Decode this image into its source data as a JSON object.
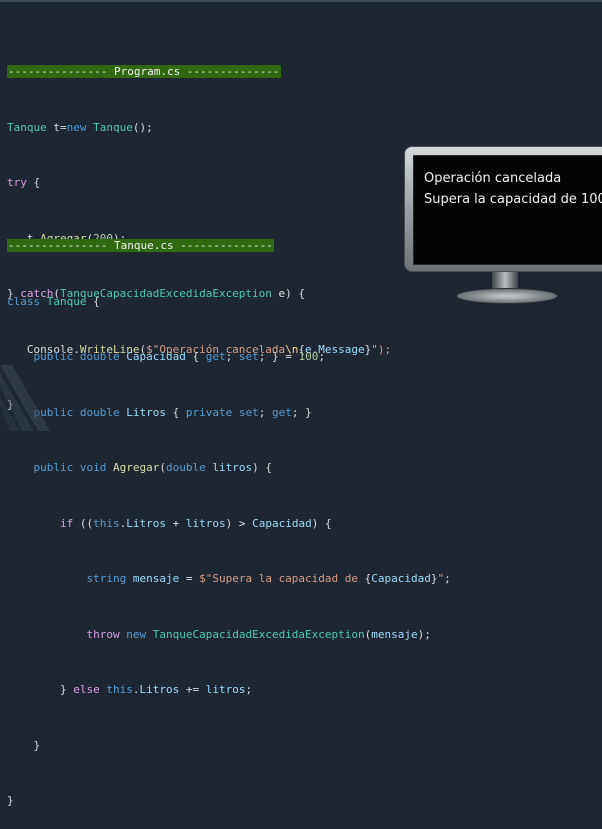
{
  "program_header": "--------------- Program.cs --------------",
  "program": {
    "l1": {
      "t1": "Tanque",
      "t2": " t=",
      "t3": "new",
      "t4": " ",
      "t5": "Tanque",
      "t6": "();"
    },
    "l2": {
      "t1": "try",
      "t2": " {"
    },
    "l3": {
      "t1": "   t.",
      "t2": "Agregar",
      "t3": "(",
      "t4": "200",
      "t5": ");"
    },
    "l4": {
      "t1": "} ",
      "t2": "catch",
      "t3": "(",
      "t4": "TanqueCapacidadExcedidaException",
      "t5": " e) {"
    },
    "l5": {
      "t1": "   Console.",
      "t2": "WriteLine",
      "t3": "(",
      "t4": "$\"Operación cancelada",
      "t5": "\\n",
      "t6": "{",
      "t7": "e.Message",
      "t8": "}",
      "t9": "\");"
    },
    "l6": {
      "t1": "}"
    }
  },
  "tanque_header": "--------------- Tanque.cs --------------",
  "tanque": {
    "l1": {
      "t1": "class",
      "t2": " ",
      "t3": "Tanque",
      "t4": " {"
    },
    "l2": {
      "t1": "    ",
      "t2": "public",
      "t3": " ",
      "t4": "double",
      "t5": " ",
      "t6": "Capacidad",
      "t7": " { ",
      "t8": "get",
      "t9": "; ",
      "t10": "set",
      "t11": "; } = ",
      "t12": "100",
      "t13": ";"
    },
    "l3": {
      "t1": "    ",
      "t2": "public",
      "t3": " ",
      "t4": "double",
      "t5": " ",
      "t6": "Litros",
      "t7": " { ",
      "t8": "private",
      "t9": " ",
      "t10": "set",
      "t11": "; ",
      "t12": "get",
      "t13": "; }"
    },
    "l4": {
      "t1": "    ",
      "t2": "public",
      "t3": " ",
      "t4": "void",
      "t5": " ",
      "t6": "Agregar",
      "t7": "(",
      "t8": "double",
      "t9": " ",
      "t10": "litros",
      "t11": ") {"
    },
    "l5": {
      "t1": "        ",
      "t2": "if",
      "t3": " ((",
      "t4": "this",
      "t5": ".",
      "t6": "Litros",
      "t7": " + ",
      "t8": "litros",
      "t9": ") > ",
      "t10": "Capacidad",
      "t11": ") {"
    },
    "l6": {
      "t1": "            ",
      "t2": "string",
      "t3": " ",
      "t4": "mensaje",
      "t5": " = ",
      "t6": "$\"Supera la capacidad de ",
      "t7": "{",
      "t8": "Capacidad",
      "t9": "}",
      "t10": "\"",
      "t11": ";"
    },
    "l7": {
      "t1": "            ",
      "t2": "throw",
      "t3": " ",
      "t4": "new",
      "t5": " ",
      "t6": "TanqueCapacidadExcedidaException",
      "t7": "(",
      "t8": "mensaje",
      "t9": ");"
    },
    "l8": {
      "t1": "        ",
      "t2": "} ",
      "t3": "else",
      "t4": " ",
      "t5": "this",
      "t6": ".",
      "t7": "Litros",
      "t8": " += ",
      "t9": "litros",
      "t10": ";"
    },
    "l9": {
      "t1": "    }"
    },
    "l10": {
      "t1": "}"
    }
  },
  "console_output": {
    "line1": "Operación cancelada",
    "line2": "Supera la capacidad de 100"
  },
  "colors": {
    "background": "#1d2631",
    "header_highlight": "#2f6a12",
    "keyword": "#569cd6",
    "control": "#d8a0df",
    "type": "#4ec9b0",
    "string": "#d69d85",
    "number": "#b5cea8"
  },
  "icons": {
    "monitor": "monitor-icon",
    "decoration": "stripes-decoration"
  }
}
